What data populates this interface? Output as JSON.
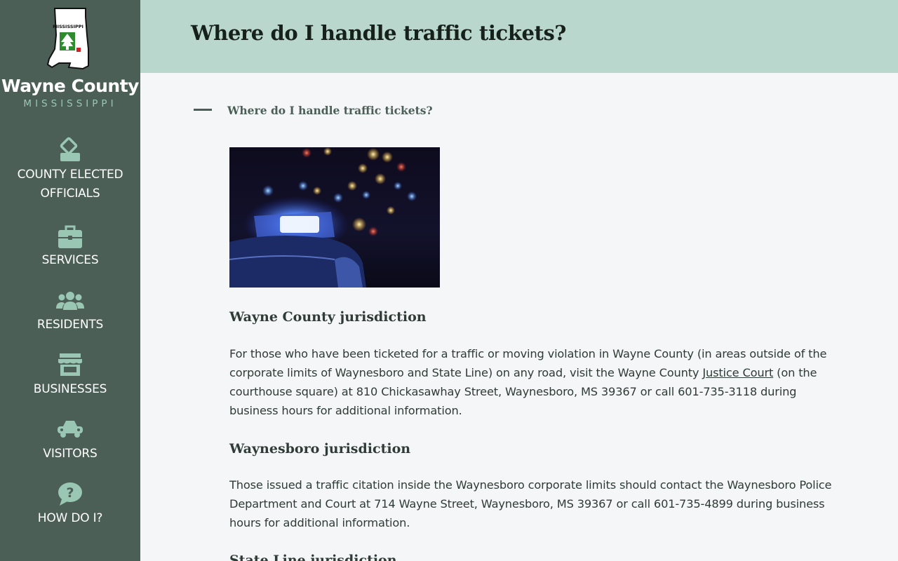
{
  "brand": {
    "name": "Wayne County",
    "state": "MISSISSIPPI",
    "logo_text": "MISSISSIPPI"
  },
  "nav": [
    {
      "label": "COUNTY ELECTED OFFICIALS",
      "icon": "ballot-box-icon"
    },
    {
      "label": "SERVICES",
      "icon": "briefcase-icon"
    },
    {
      "label": "RESIDENTS",
      "icon": "users-icon"
    },
    {
      "label": "BUSINESSES",
      "icon": "store-icon"
    },
    {
      "label": "VISITORS",
      "icon": "car-icon"
    },
    {
      "label": "HOW DO I?",
      "icon": "question-chat-icon"
    }
  ],
  "header": {
    "title": "Where do I handle traffic tickets?"
  },
  "accordion": {
    "title": "Where do I handle traffic tickets?",
    "expanded": true
  },
  "sections": [
    {
      "heading": "Wayne County jurisdiction",
      "text_before_link": "For those who have been ticketed for a traffic or moving violation in Wayne County (in areas outside of the corporate limits of Waynesboro and State Line) on any road, visit the Wayne County ",
      "link": "Justice Court",
      "text_after_link": " (on the courthouse square) at 810 Chickasawhay Street, Waynesboro, MS 39367 or call 601-735-3118 during business hours for additional information."
    },
    {
      "heading": "Waynesboro jurisdiction",
      "text": "Those issued a traffic citation inside the Waynesboro corporate limits should contact the Waynesboro Police Department and Court at 714 Wayne Street, Waynesboro, MS 39367 or call 601-735-4899 during business hours for additional information."
    },
    {
      "heading": "State Line jurisdiction"
    }
  ],
  "colors": {
    "sidebar": "#4b5f57",
    "header": "#bad7cd",
    "accent": "#9ac7b4",
    "background": "#f4f6f7"
  }
}
